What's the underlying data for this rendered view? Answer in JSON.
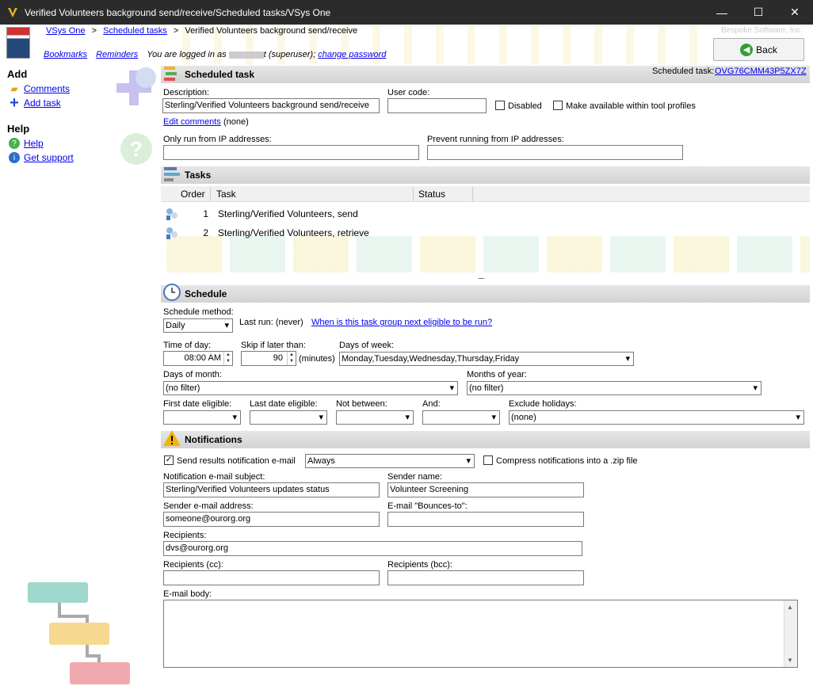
{
  "window": {
    "title": "Verified Volunteers background send/receive/Scheduled tasks/VSys One",
    "minimize": "—",
    "maximize": "☐",
    "close": "✕"
  },
  "breadcrumb": {
    "home": "VSys One",
    "sep": ">",
    "section": "Scheduled tasks",
    "current": "Verified Volunteers background send/receive"
  },
  "brand": "Bespoke Software, Inc.",
  "userbar": {
    "bookmarks": "Bookmarks",
    "reminders": "Reminders",
    "logged_prefix": "You are logged in as",
    "logged_suffix": "t (superuser);",
    "change_password": "change password"
  },
  "back": "Back",
  "sidebar": {
    "add_heading": "Add",
    "comments": "Comments",
    "add_task": "Add task",
    "help_heading": "Help",
    "help": "Help",
    "support": "Get support"
  },
  "sched": {
    "heading": "Scheduled task",
    "id_label": "Scheduled task:",
    "id_value": "OVG76CMM43P5ZX7Z",
    "desc_label": "Description:",
    "desc_value": "Sterling/Verified Volunteers background send/receive",
    "usercode_label": "User code:",
    "usercode_value": "",
    "disabled": "Disabled",
    "tool_profiles": "Make available within tool profiles",
    "edit_comments": "Edit comments",
    "none": "(none)",
    "only_ip": "Only run from IP addresses:",
    "prevent_ip": "Prevent running from IP addresses:"
  },
  "tasks": {
    "heading": "Tasks",
    "col_order": "Order",
    "col_task": "Task",
    "col_status": "Status",
    "rows": [
      {
        "order": "1",
        "task": "Sterling/Verified Volunteers, send"
      },
      {
        "order": "2",
        "task": "Sterling/Verified Volunteers, retrieve"
      }
    ],
    "more": "......"
  },
  "schedule": {
    "heading": "Schedule",
    "method_label": "Schedule method:",
    "method_value": "Daily",
    "last_run": "Last run: (never)",
    "eligible_link": "When is this task group next eligible to be run?",
    "tod_label": "Time of day:",
    "tod_value": "08:00 AM",
    "skip_label": "Skip if later than:",
    "skip_value": "90",
    "minutes": "(minutes)",
    "dow_label": "Days of week:",
    "dow_value": "Monday,Tuesday,Wednesday,Thursday,Friday",
    "dom_label": "Days of month:",
    "dom_value": "(no filter)",
    "moy_label": "Months of year:",
    "moy_value": "(no filter)",
    "first_label": "First date eligible:",
    "last_label": "Last date eligible:",
    "notbetween_label": "Not between:",
    "and_label": "And:",
    "holidays_label": "Exclude holidays:",
    "holidays_value": "(none)"
  },
  "notif": {
    "heading": "Notifications",
    "send_label": "Send results notification e-mail",
    "send_value": "Always",
    "compress": "Compress notifications into a .zip file",
    "subject_label": "Notification e-mail subject:",
    "subject_value": "Sterling/Verified Volunteers updates status",
    "sender_name_label": "Sender name:",
    "sender_name_value": "Volunteer Screening",
    "sender_addr_label": "Sender e-mail address:",
    "sender_addr_value": "someone@ourorg.org",
    "bounces_label": "E-mail \"Bounces-to\":",
    "recipients_label": "Recipients:",
    "recipients_value": "dvs@ourorg.org",
    "cc_label": "Recipients (cc):",
    "bcc_label": "Recipients (bcc):",
    "body_label": "E-mail body:"
  }
}
